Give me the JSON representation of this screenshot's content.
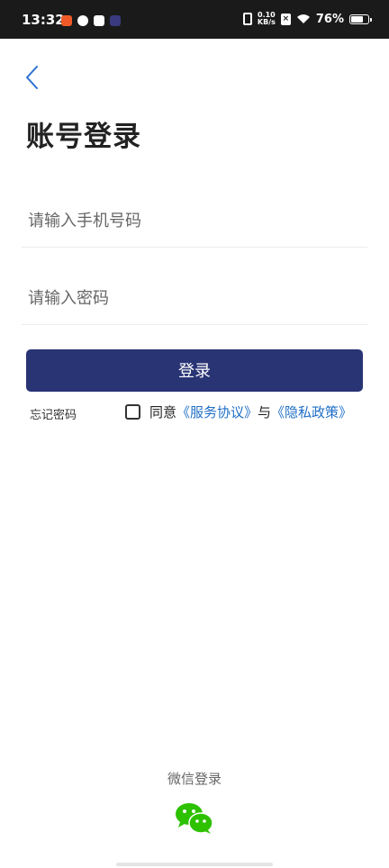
{
  "status_bar": {
    "time": "13:32",
    "net_speed_value": "0.10",
    "net_speed_unit": "KB/s",
    "battery_percent": "76%",
    "battery_level": 0.76
  },
  "page": {
    "title": "账号登录"
  },
  "form": {
    "phone_placeholder": "请输入手机号码",
    "password_placeholder": "请输入密码",
    "login_label": "登录",
    "forgot_label": "忘记密码",
    "agree_prefix": "同意",
    "service_agreement": "《服务协议》",
    "agree_and": "与",
    "privacy_policy": "《隐私政策》"
  },
  "footer": {
    "wechat_login_label": "微信登录"
  },
  "colors": {
    "primary": "#293475",
    "link": "#1f6fc7",
    "wechat": "#2dc100",
    "back_arrow": "#2a6fd0"
  }
}
